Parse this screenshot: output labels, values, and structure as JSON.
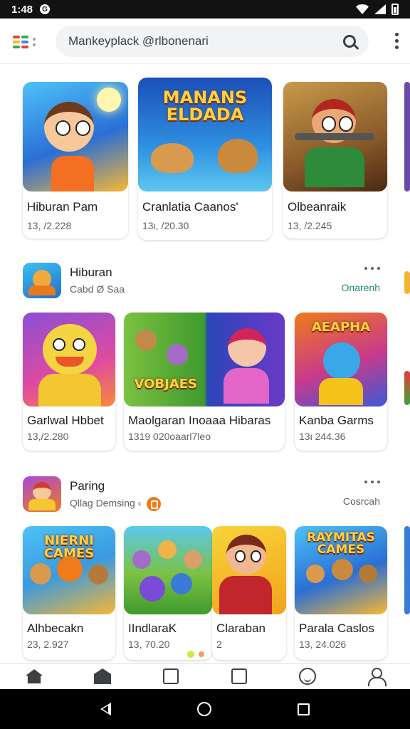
{
  "status_bar": {
    "time": "1:48",
    "notification": "G"
  },
  "app_bar": {
    "search_query": "Mankeyplack @rlbonenari"
  },
  "row1": [
    {
      "title": "Hiburan Pam",
      "sub": "13, /2.228"
    },
    {
      "title": "Cranlatia Caanos'",
      "sub": "13ι, /20.30",
      "banner": "MANANS ELDADA"
    },
    {
      "title": "Olbeanraik",
      "sub": "13, /2.245"
    }
  ],
  "section2": {
    "title": "Hiburan",
    "subtitle": "Cabd Ø Saa",
    "link": "Onarenh",
    "cards": [
      {
        "title": "Garlwal Hbbet",
        "sub": "13,/2.280"
      },
      {
        "title": "Maolgaran Inoaaa Hibaras",
        "sub": "1319 020oaarl7leo",
        "banner": "VOBJAES"
      },
      {
        "title": "Kanba Garms",
        "sub": "13ι 244.36",
        "banner": "AEAPHA"
      }
    ]
  },
  "section3": {
    "title": "Paring",
    "subtitle": "Qllag Demsing ‹",
    "link": "Cosrcah",
    "cards": [
      {
        "title": "Alhbecakn",
        "sub": "23, 2.927",
        "banner": "NIERNI CAMES"
      },
      {
        "title": "IIndlaraK",
        "sub": "13, 70.20"
      },
      {
        "title": "Claraban",
        "sub": "2"
      },
      {
        "title": "Parala Caslos",
        "sub": "13, 24.026",
        "banner": "RAYMITAS CAMES"
      }
    ]
  },
  "colors": {
    "accent": "#1a8a7a",
    "link": "#1a8a7a",
    "page_dot_active": "#d7e63a",
    "page_dot": "#f3a060"
  }
}
